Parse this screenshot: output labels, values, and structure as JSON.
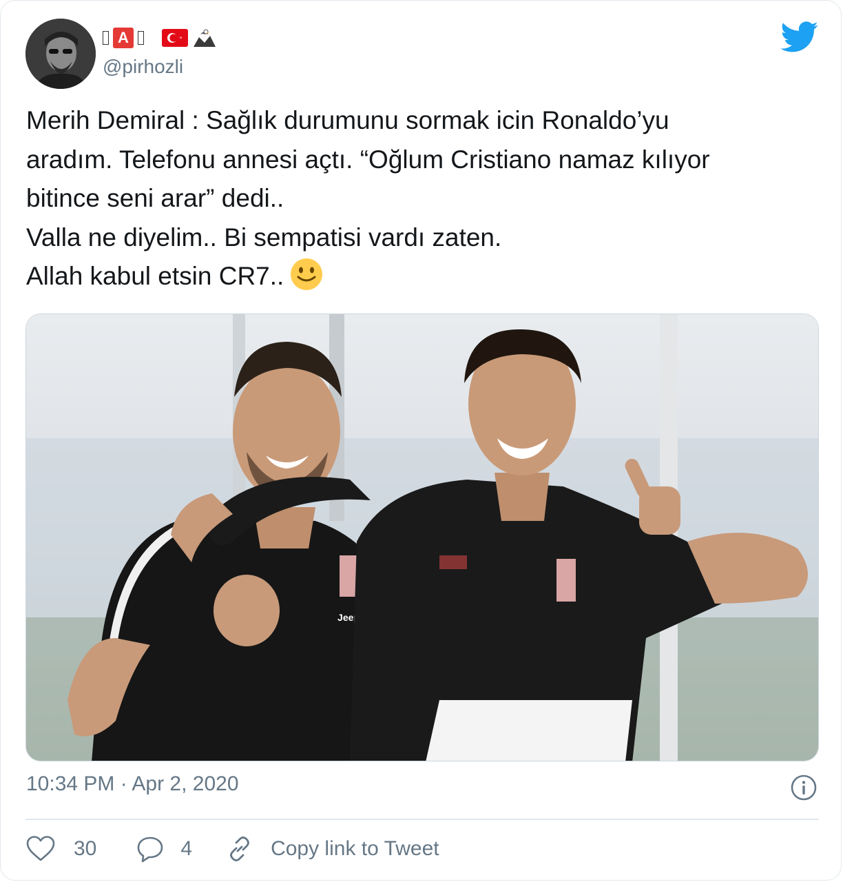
{
  "user": {
    "display_name_badge": "A",
    "flag_icon": "turkey-flag-icon",
    "extra_icon": "eagle-icon",
    "handle": "@pirhozli"
  },
  "brand": {
    "icon": "twitter-bird-icon",
    "color": "#1da1f2"
  },
  "tweet": {
    "lines": [
      "Merih Demiral : Sağlık durumunu sormak icin Ronaldo’yu",
      "aradım. Telefonu annesi açtı. “Oğlum Cristiano namaz kılıyor",
      "bitince seni arar” dedi..",
      "Valla ne diyelim.. Bi sempatisi vardı zaten.",
      "Allah kabul etsin CR7.."
    ],
    "emoji": "slightly-smiling-face"
  },
  "media": {
    "description_icon": "photo-two-football-players",
    "jersey_text": "Jeep"
  },
  "meta": {
    "timestamp": "10:34 PM · Apr 2, 2020"
  },
  "actions": {
    "likes": "30",
    "replies": "4",
    "copy_link_label": "Copy link to Tweet"
  },
  "colors": {
    "text": "#14171a",
    "secondary": "#657786",
    "border": "#e1e8ed",
    "accent": "#1da1f2"
  }
}
